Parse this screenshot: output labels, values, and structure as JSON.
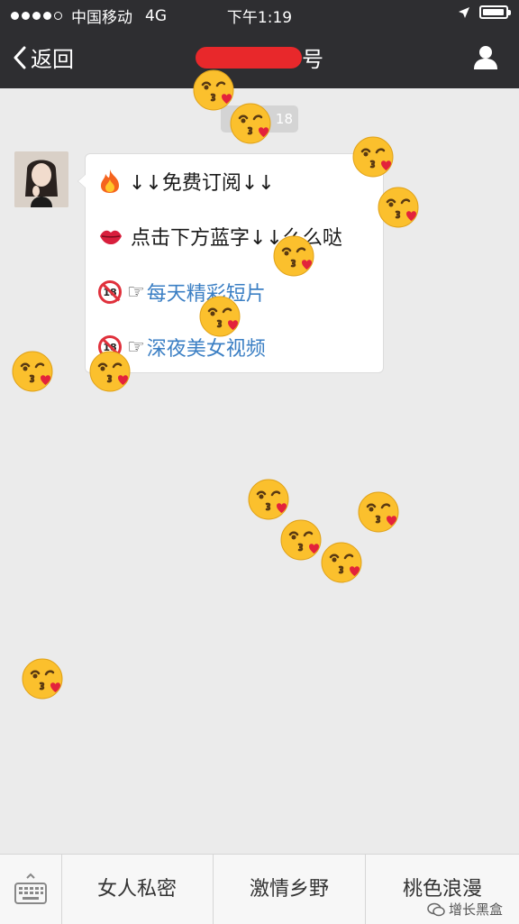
{
  "status_bar": {
    "carrier": "中国移动",
    "network": "4G",
    "time": "下午1:19"
  },
  "nav": {
    "back_label": "返回",
    "title_suffix": "号"
  },
  "chat": {
    "timestamp": "18",
    "message": {
      "line1": "↓↓免费订阅↓↓",
      "line2": "点击下方蓝字↓↓么么哒",
      "link1_pointer": "☞",
      "link1": "每天精彩短片",
      "link2_pointer": "☞",
      "link2": "深夜美女视频"
    }
  },
  "menu": {
    "items": [
      "女人私密",
      "激情乡野",
      "桃色浪漫"
    ]
  },
  "watermark": "增长黑盒",
  "colors": {
    "nav_bg": "#2e2e31",
    "chat_bg": "#ebebeb",
    "link": "#3b7fc4",
    "redaction": "#e8282b"
  },
  "icons": [
    "fire-icon",
    "kiss-lips-icon",
    "no-under-18-icon",
    "kiss-face-emoji",
    "keyboard-icon",
    "profile-icon",
    "back-chevron-icon"
  ]
}
